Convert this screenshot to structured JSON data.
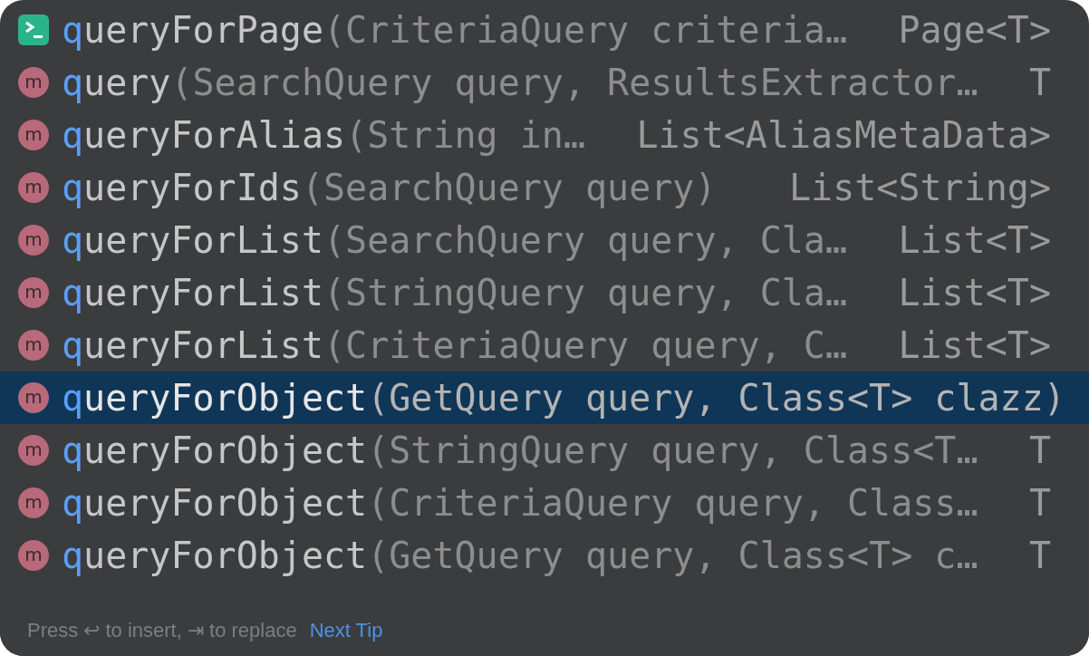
{
  "items": [
    {
      "kind": "template",
      "matched": "q",
      "rest": "ueryForPage",
      "params": "(CriteriaQuery criteria…",
      "type": "Page<T>",
      "selected": false
    },
    {
      "kind": "method",
      "icon": "m",
      "matched": "q",
      "rest": "uery",
      "params": "(SearchQuery query, ResultsExtractor…",
      "type": "T",
      "selected": false
    },
    {
      "kind": "method",
      "icon": "m",
      "matched": "q",
      "rest": "ueryForAlias",
      "params": "(String in…",
      "type": "List<AliasMetaData>",
      "selected": false
    },
    {
      "kind": "method",
      "icon": "m",
      "matched": "q",
      "rest": "ueryForIds",
      "params": "(SearchQuery query)",
      "type": "List<String>",
      "selected": false
    },
    {
      "kind": "method",
      "icon": "m",
      "matched": "q",
      "rest": "ueryForList",
      "params": "(SearchQuery query, Cla…",
      "type": "List<T>",
      "selected": false
    },
    {
      "kind": "method",
      "icon": "m",
      "matched": "q",
      "rest": "ueryForList",
      "params": "(StringQuery query, Cla…",
      "type": "List<T>",
      "selected": false
    },
    {
      "kind": "method",
      "icon": "m",
      "matched": "q",
      "rest": "ueryForList",
      "params": "(CriteriaQuery query, C…",
      "type": "List<T>",
      "selected": false
    },
    {
      "kind": "method",
      "icon": "m",
      "matched": "q",
      "rest": "ueryForObject",
      "params": "(GetQuery query, Class<T> clazz)",
      "selected": true
    },
    {
      "kind": "method",
      "icon": "m",
      "matched": "q",
      "rest": "ueryForObject",
      "params": "(StringQuery query, Class<T…",
      "type": "T",
      "selected": false
    },
    {
      "kind": "method",
      "icon": "m",
      "matched": "q",
      "rest": "ueryForObject",
      "params": "(CriteriaQuery query, Class…",
      "type": "T",
      "selected": false
    },
    {
      "kind": "method",
      "icon": "m",
      "matched": "q",
      "rest": "ueryForObject",
      "params": "(GetQuery query, Class<T> c…",
      "type": "T",
      "selected": false
    }
  ],
  "footer": {
    "hint": "Press ↩ to insert, ⇥ to replace",
    "link": "Next Tip"
  }
}
